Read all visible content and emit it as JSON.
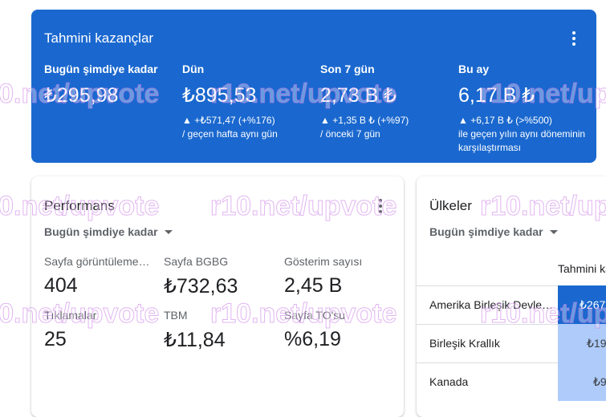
{
  "earnings": {
    "title": "Tahmini kazançlar",
    "metrics": [
      {
        "label": "Bugün şimdiye kadar",
        "value": "₺295,98",
        "delta": "",
        "note": ""
      },
      {
        "label": "Dün",
        "value": "₺895,53",
        "delta": "▲ +₺571,47 (+%176)",
        "note": "/ geçen hafta aynı gün"
      },
      {
        "label": "Son 7 gün",
        "value": "2,73 B ₺",
        "delta": "▲ +1,35 B ₺ (+%97)",
        "note": "/ önceki 7 gün"
      },
      {
        "label": "Bu ay",
        "value": "6,17 B ₺",
        "delta": "▲ +6,17 B ₺ (>%500)",
        "note": "ile geçen yılın aynı döneminin karşılaştırması"
      }
    ]
  },
  "performance": {
    "title": "Performans",
    "range": "Bugün şimdiye kadar",
    "items": [
      {
        "label": "Sayfa görüntülemeleri",
        "value": "404"
      },
      {
        "label": "Sayfa BGBG",
        "value": "₺732,63"
      },
      {
        "label": "Gösterim sayısı",
        "value": "2,45 B"
      },
      {
        "label": "Tıklamalar",
        "value": "25"
      },
      {
        "label": "TBM",
        "value": "₺11,84"
      },
      {
        "label": "Sayfa TO'su",
        "value": "%6,19"
      }
    ]
  },
  "countries": {
    "title": "Ülkeler",
    "range": "Bugün şimdiye kadar",
    "column_header": "Tahmini kazançlar",
    "rows": [
      {
        "name": "Amerika Birleşik Devletleri",
        "value": "₺267",
        "share": 1.0
      },
      {
        "name": "Birleşik Krallık",
        "value": "₺19",
        "share": 0.07
      },
      {
        "name": "Kanada",
        "value": "₺9",
        "share": 0.03
      }
    ]
  },
  "colors": {
    "brand": "#1a68cf",
    "cell_strong": "#1a68cf",
    "cell_light": "#aecbfa"
  },
  "watermark": "r10.net/upvote"
}
